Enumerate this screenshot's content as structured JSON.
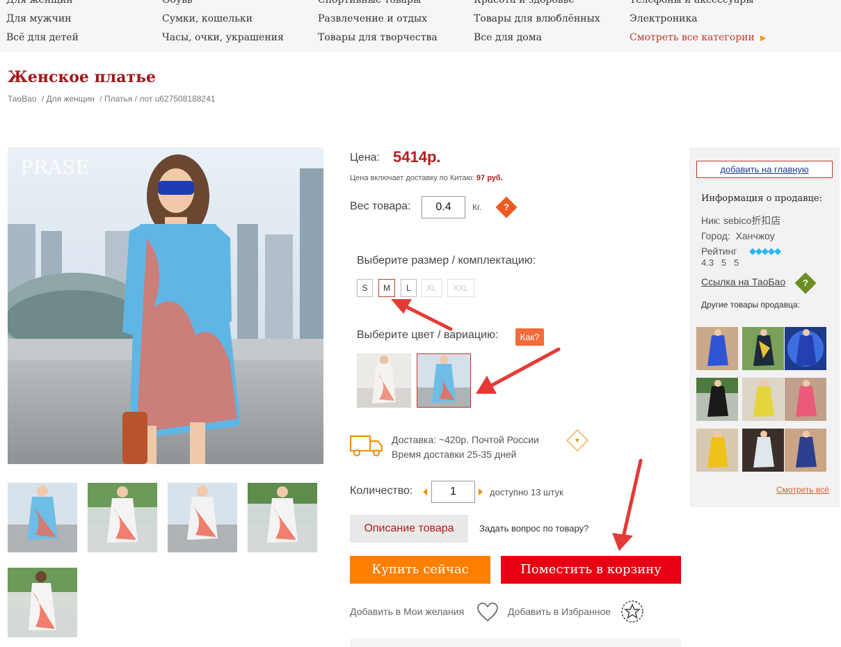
{
  "categories": {
    "col1": [
      "Для женщин",
      "Для мужчин",
      "Всё для детей"
    ],
    "col2": [
      "Обувь",
      "Сумки, кошельки",
      "Часы, очки, украшения"
    ],
    "col3": [
      "Спортивные товары",
      "Развлечение и отдых",
      "Товары для творчества"
    ],
    "col4": [
      "Красота и здоровье",
      "Товары для влюблённых",
      "Все для дома"
    ],
    "col5": [
      "Телефоны и аксессуары",
      "Электроника",
      "Смотреть все категории"
    ]
  },
  "product": {
    "title": "Женское платье",
    "breadcrumb": [
      "ТаоВао",
      "/ Для женщин",
      "/ Платья / лот u627508188241"
    ],
    "watermark": "PRASE",
    "price_label": "Цена:",
    "price": "5414р.",
    "price_note": "Цена включает доставку по Китаю:",
    "price_note_value": "97 руб.",
    "weight_label": "Вес товара:",
    "weight_value": "0.4",
    "weight_unit": "Кг.",
    "help_glyph": "?",
    "size_label": "Выберите размер / комплектацию:",
    "sizes": [
      "S",
      "M",
      "L",
      "XL",
      "XXL"
    ],
    "color_label": "Выберите цвет / вариацию:",
    "how_label": "Как?",
    "delivery_line1": "Доставка:  ~420р.  Почтой России",
    "delivery_line2": "Время доставки 25-35 дней",
    "qty_label": "Количество:",
    "qty_value": "1",
    "qty_available": "доступно 13 штук",
    "desc_button": "Описание товара",
    "ask_link": "Задать вопрос по товару?",
    "buy_now": "Купить сейчас",
    "to_cart": "Поместить в корзину",
    "add_wishlist": "Добавить в Мои желания",
    "add_favorites": "Добавить в Избранное"
  },
  "seller": {
    "add_to_main": "добавить на главную",
    "info_title": "Информация о продавце:",
    "nick_label": "Ник:",
    "nick": "sebico折扣店",
    "city_label": "Город:",
    "city": "Ханчжоу",
    "rating_label": "Рейтинг",
    "rating_scores": "4.3   5   5",
    "taobao_link": "Ссылка на ТаоБао",
    "other_goods": "Другие товары продавца:",
    "see_all": "Смотреть всё"
  },
  "colors": {
    "accent_red": "#b71c1c",
    "buy_orange": "#ff7f00",
    "cart_red": "#e60012",
    "diamond_blue": "#29b6f6",
    "arrow_red": "#e53935"
  }
}
